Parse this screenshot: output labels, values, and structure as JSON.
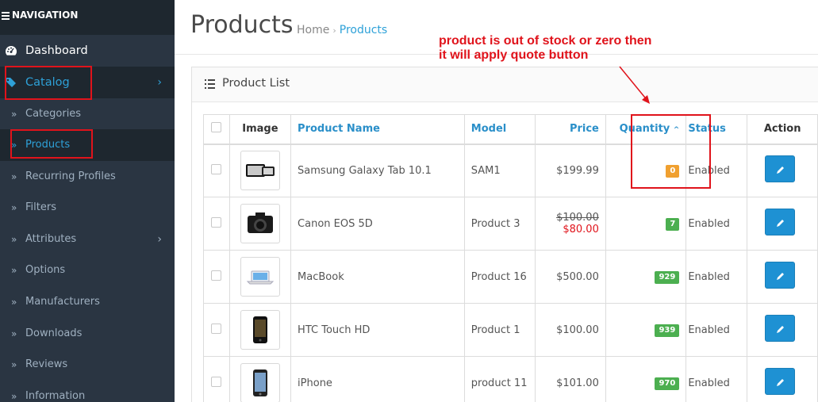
{
  "nav": {
    "header": "NAVIGATION",
    "dashboard": "Dashboard",
    "catalog": "Catalog",
    "sub_items": [
      "Categories",
      "Products",
      "Recurring Profiles",
      "Filters",
      "Attributes",
      "Options",
      "Manufacturers",
      "Downloads",
      "Reviews",
      "Information"
    ]
  },
  "page": {
    "title": "Products",
    "breadcrumb_home": "Home",
    "breadcrumb_current": "Products"
  },
  "annotation": {
    "line1": "product is out of stock or zero then",
    "line2": "it will apply quote button"
  },
  "panel": {
    "title": "Product List"
  },
  "table": {
    "headers": {
      "image": "Image",
      "name": "Product Name",
      "model": "Model",
      "price": "Price",
      "quantity": "Quantity",
      "status": "Status",
      "action": "Action"
    },
    "rows": [
      {
        "name": "Samsung Galaxy Tab 10.1",
        "model": "SAM1",
        "price": "$199.99",
        "special": "",
        "quantity": "0",
        "status": "Enabled"
      },
      {
        "name": "Canon EOS 5D",
        "model": "Product 3",
        "price": "$100.00",
        "special": "$80.00",
        "quantity": "7",
        "status": "Enabled"
      },
      {
        "name": "MacBook",
        "model": "Product 16",
        "price": "$500.00",
        "special": "",
        "quantity": "929",
        "status": "Enabled"
      },
      {
        "name": "HTC Touch HD",
        "model": "Product 1",
        "price": "$100.00",
        "special": "",
        "quantity": "939",
        "status": "Enabled"
      },
      {
        "name": "iPhone",
        "model": "product 11",
        "price": "$101.00",
        "special": "",
        "quantity": "970",
        "status": "Enabled"
      }
    ]
  },
  "colors": {
    "sidebar": "#2a3542",
    "sidebar_active": "#1e272f",
    "accent": "#2ea1d8",
    "annotation": "#e0131b",
    "badge_warning": "#f0a030",
    "badge_success": "#4caf50",
    "button": "#1e91d3"
  }
}
